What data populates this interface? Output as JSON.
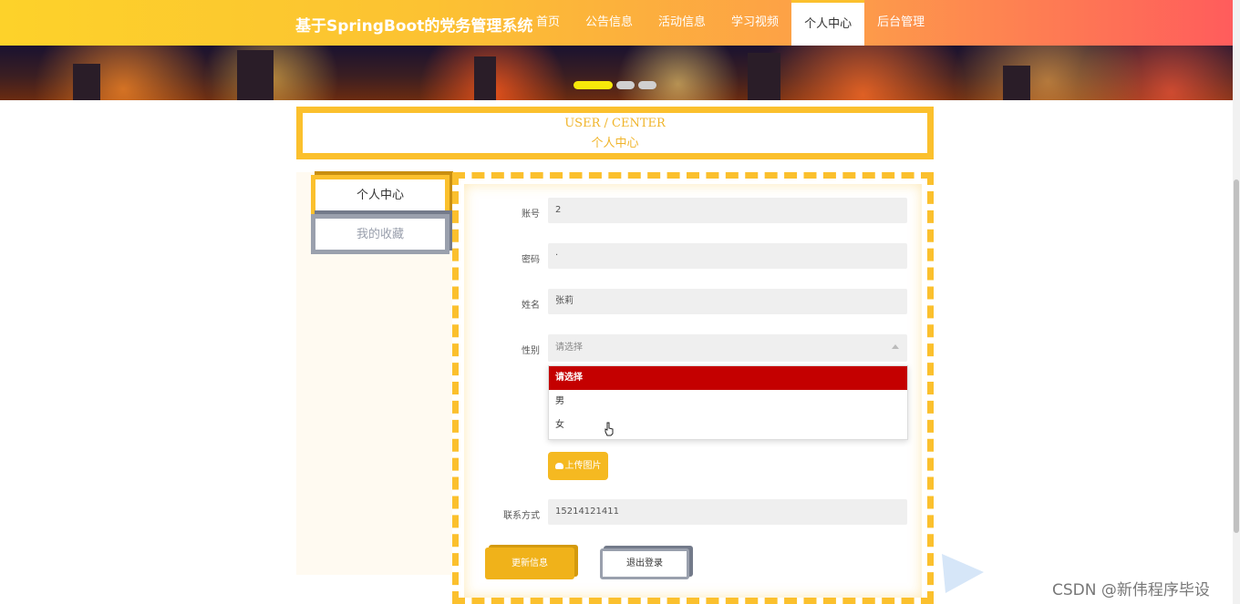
{
  "header": {
    "brand": "基于SpringBoot的党务管理系统",
    "nav": [
      {
        "label": "首页"
      },
      {
        "label": "公告信息"
      },
      {
        "label": "活动信息"
      },
      {
        "label": "学习视频"
      },
      {
        "label": "个人中心",
        "active": true
      },
      {
        "label": "后台管理"
      }
    ]
  },
  "banner": {
    "slides": 3,
    "active_slide": 1
  },
  "section_title": {
    "en": "USER / CENTER",
    "cn": "个人中心"
  },
  "sidebar": {
    "items": [
      {
        "label": "个人中心",
        "active": true
      },
      {
        "label": "我的收藏"
      }
    ]
  },
  "form": {
    "account": {
      "label": "账号",
      "value": "2"
    },
    "password": {
      "label": "密码",
      "value": "·"
    },
    "name": {
      "label": "姓名",
      "value": "张莉"
    },
    "gender": {
      "label": "性别",
      "placeholder": "请选择",
      "options": [
        "请选择",
        "男",
        "女"
      ],
      "highlighted": "请选择"
    },
    "upload_label": "上传图片",
    "phone": {
      "label": "联系方式",
      "value": "15214121411"
    },
    "update_label": "更新信息",
    "logout_label": "退出登录"
  },
  "watermark": "CSDN @新伟程序毕设",
  "colors": {
    "accent": "#fbc02d",
    "selected_option": "#c40000",
    "secondary": "#9aa0ad"
  }
}
